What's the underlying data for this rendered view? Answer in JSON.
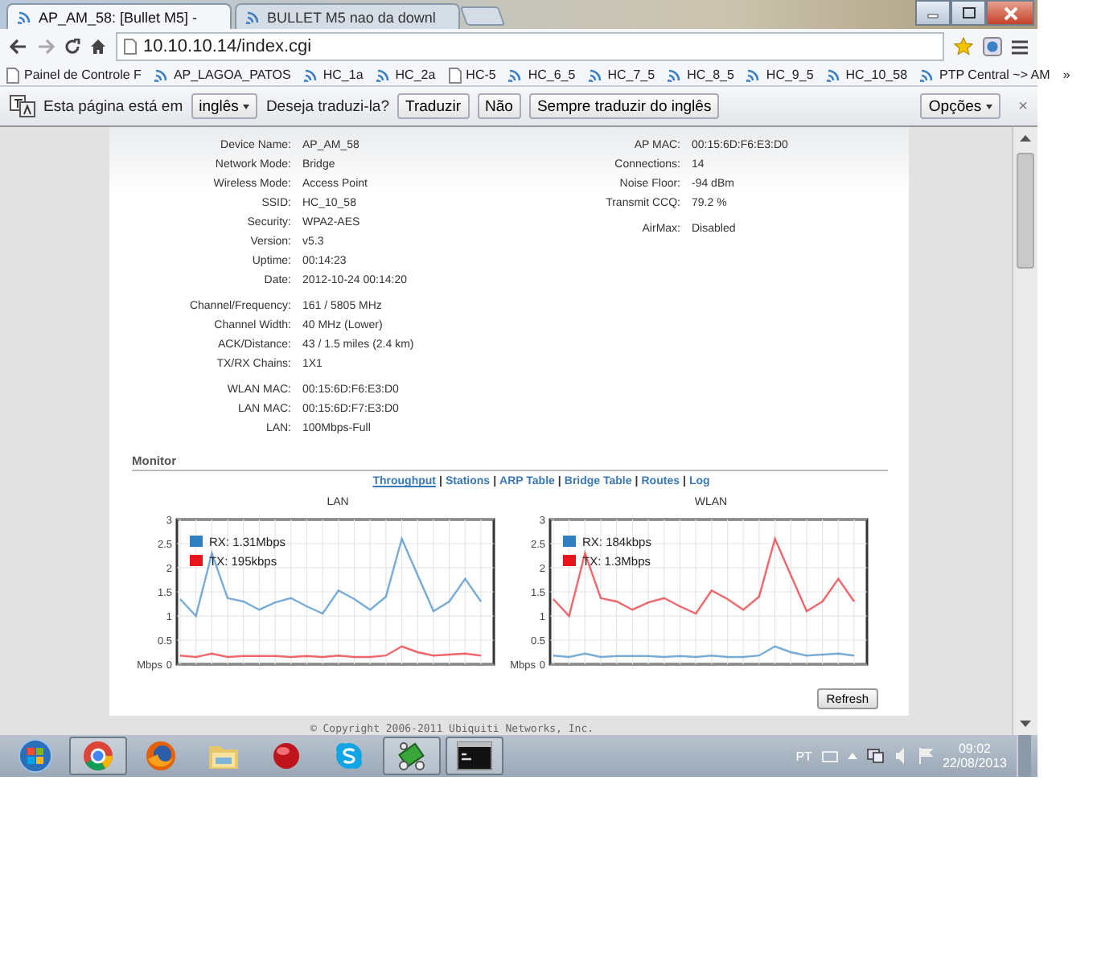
{
  "browser": {
    "tabs": [
      {
        "title": "AP_AM_58: [Bullet M5] -",
        "selected": true
      },
      {
        "title": "BULLET M5 nao da downl",
        "selected": false
      }
    ],
    "address": "10.10.10.14/index.cgi",
    "bookmarks": [
      {
        "label": "Painel de Controle F",
        "kind": "page"
      },
      {
        "label": "AP_LAGOA_PATOS",
        "kind": "feed"
      },
      {
        "label": "HC_1a",
        "kind": "feed"
      },
      {
        "label": "HC_2a",
        "kind": "feed"
      },
      {
        "label": "HC-5",
        "kind": "page"
      },
      {
        "label": "HC_6_5",
        "kind": "feed"
      },
      {
        "label": "HC_7_5",
        "kind": "feed"
      },
      {
        "label": "HC_8_5",
        "kind": "feed"
      },
      {
        "label": "HC_9_5",
        "kind": "feed"
      },
      {
        "label": "HC_10_58",
        "kind": "feed"
      },
      {
        "label": "PTP Central ~> AM",
        "kind": "feed"
      }
    ],
    "bookmarks_more": "»"
  },
  "translate_bar": {
    "prefix": "Esta página está em",
    "language": "inglês",
    "question": "Deseja traduzi-la?",
    "buttons": [
      "Traduzir",
      "Não",
      "Sempre traduzir do inglês"
    ],
    "options": "Opções",
    "close": "×"
  },
  "status": {
    "left": [
      [
        {
          "label": "Device Name:",
          "value": "AP_AM_58"
        },
        {
          "label": "Network Mode:",
          "value": "Bridge"
        },
        {
          "label": "Wireless Mode:",
          "value": "Access Point"
        },
        {
          "label": "SSID:",
          "value": "HC_10_58"
        },
        {
          "label": "Security:",
          "value": "WPA2-AES"
        },
        {
          "label": "Version:",
          "value": "v5.3"
        },
        {
          "label": "Uptime:",
          "value": "00:14:23"
        },
        {
          "label": "Date:",
          "value": "2012-10-24 00:14:20"
        }
      ],
      [
        {
          "label": "Channel/Frequency:",
          "value": "161 / 5805 MHz"
        },
        {
          "label": "Channel Width:",
          "value": "40 MHz (Lower)"
        },
        {
          "label": "ACK/Distance:",
          "value": "43 / 1.5 miles (2.4 km)"
        },
        {
          "label": "TX/RX Chains:",
          "value": "1X1"
        }
      ],
      [
        {
          "label": "WLAN MAC:",
          "value": "00:15:6D:F6:E3:D0"
        },
        {
          "label": "LAN MAC:",
          "value": "00:15:6D:F7:E3:D0"
        },
        {
          "label": "LAN:",
          "value": "100Mbps-Full"
        }
      ]
    ],
    "right": [
      [
        {
          "label": "AP MAC:",
          "value": "00:15:6D:F6:E3:D0"
        },
        {
          "label": "Connections:",
          "value": "14"
        },
        {
          "label": "Noise Floor:",
          "value": "-94 dBm"
        },
        {
          "label": "Transmit CCQ:",
          "value": "79.2 %"
        }
      ],
      [
        {
          "label": "AirMax:",
          "value": "Disabled"
        }
      ]
    ]
  },
  "monitor": {
    "title": "Monitor",
    "separator": "|",
    "tabs": [
      {
        "label": "Throughput",
        "selected": true
      },
      {
        "label": "Stations",
        "selected": false
      },
      {
        "label": "ARP Table",
        "selected": false
      },
      {
        "label": "Bridge Table",
        "selected": false
      },
      {
        "label": "Routes",
        "selected": false
      },
      {
        "label": "Log",
        "selected": false
      }
    ],
    "charts": [
      {
        "chart_data": {
          "type": "line",
          "title": "LAN",
          "ylabel": "Mbps",
          "grid": true,
          "legend": true,
          "ylim": [
            0,
            3
          ],
          "yticks": [
            0,
            0.5,
            1,
            1.5,
            2,
            2.5,
            3
          ],
          "series": [
            {
              "name": "RX: 1.31Mbps",
              "color": "#2f7fc1",
              "values": [
                1.35,
                1.0,
                2.3,
                1.37,
                1.3,
                1.13,
                1.28,
                1.37,
                1.2,
                1.05,
                1.53,
                1.35,
                1.13,
                1.4,
                2.6,
                1.85,
                1.1,
                1.3,
                1.77,
                1.3
              ]
            },
            {
              "name": "TX: 195kbps",
              "color": "#e8161b",
              "values": [
                0.18,
                0.15,
                0.22,
                0.15,
                0.17,
                0.17,
                0.17,
                0.15,
                0.17,
                0.15,
                0.18,
                0.15,
                0.15,
                0.18,
                0.37,
                0.25,
                0.18,
                0.2,
                0.22,
                0.18
              ]
            }
          ]
        }
      },
      {
        "chart_data": {
          "type": "line",
          "title": "WLAN",
          "ylabel": "Mbps",
          "grid": true,
          "legend": true,
          "ylim": [
            0,
            3
          ],
          "yticks": [
            0,
            0.5,
            1,
            1.5,
            2,
            2.5,
            3
          ],
          "series": [
            {
              "name": "RX: 184kbps",
              "color": "#2f7fc1",
              "values": [
                0.18,
                0.15,
                0.22,
                0.15,
                0.17,
                0.17,
                0.17,
                0.15,
                0.17,
                0.15,
                0.18,
                0.15,
                0.15,
                0.18,
                0.37,
                0.25,
                0.18,
                0.2,
                0.22,
                0.18
              ]
            },
            {
              "name": "TX: 1.3Mbps",
              "color": "#e8161b",
              "values": [
                1.35,
                1.0,
                2.3,
                1.37,
                1.3,
                1.13,
                1.28,
                1.37,
                1.2,
                1.05,
                1.53,
                1.35,
                1.13,
                1.4,
                2.6,
                1.85,
                1.1,
                1.3,
                1.77,
                1.3
              ]
            }
          ]
        }
      }
    ],
    "refresh": "Refresh"
  },
  "footer": "© Copyright 2006-2011 Ubiquiti Networks, Inc.",
  "taskbar": {
    "apps": [
      {
        "kind": "start",
        "open": false
      },
      {
        "kind": "chrome",
        "open": true
      },
      {
        "kind": "firefox",
        "open": false
      },
      {
        "kind": "folder",
        "open": false
      },
      {
        "kind": "ball",
        "open": false
      },
      {
        "kind": "skype",
        "open": false
      },
      {
        "kind": "chip",
        "open": true
      },
      {
        "kind": "terminal",
        "open": true
      }
    ],
    "language": "PT",
    "time": "09:02",
    "date": "22/08/2013"
  }
}
